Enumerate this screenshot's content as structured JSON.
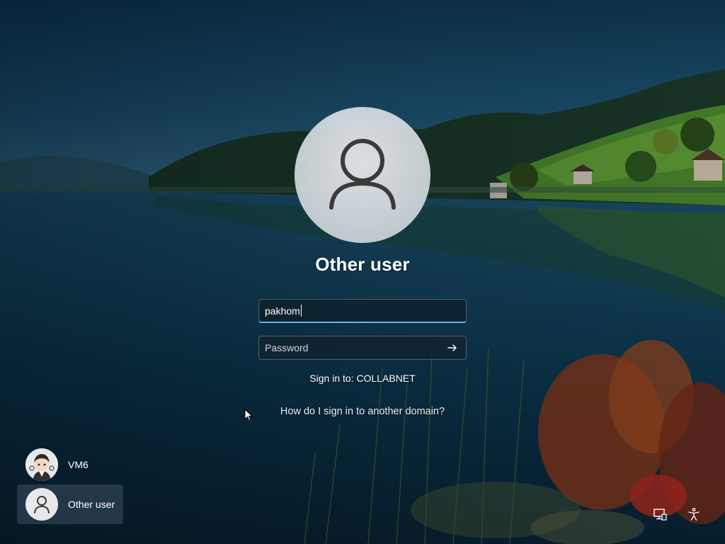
{
  "login": {
    "title": "Other user",
    "username_value": "pakhom",
    "password_placeholder": "Password",
    "signin_to": "Sign in to: COLLABNET",
    "domain_link": "How do I sign in to another domain?"
  },
  "users": [
    {
      "name": "VM6",
      "selected": false
    },
    {
      "name": "Other user",
      "selected": true
    }
  ],
  "icons": {
    "submit": "arrow-right-icon",
    "network": "network-icon",
    "accessibility": "accessibility-icon"
  },
  "colors": {
    "focus_underline": "#5fb2f2",
    "sky_top": "#123d5c",
    "water": "#0d3b55"
  }
}
